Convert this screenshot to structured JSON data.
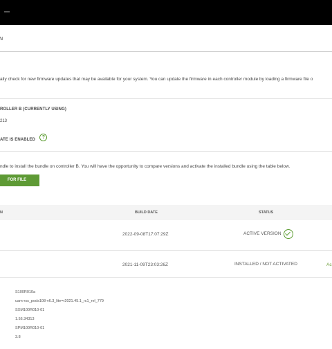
{
  "header": {
    "title": "N"
  },
  "intro": "ally check for new firmware updates that may be available for your system. You can update the firmware in each controller module by loading a firmware file o",
  "controller": {
    "heading": "ROLLER B (CURRENTLY USING)",
    "version": "213",
    "auto_update_label": "ATE IS ENABLED",
    "help_icon": "?"
  },
  "upload": {
    "instructions": "ndle to install the bundle on controller B. You will have the opportunity to compare versions and activate the installed bundle using the table below.",
    "button_label": "FOR FILE"
  },
  "table": {
    "headers": {
      "name": "N",
      "build_date": "BUILD DATE",
      "status": "STATUS"
    },
    "rows": [
      {
        "build_date": "2022-09-08T17:07:29Z",
        "status": "ACTIVE VERSION",
        "action": ""
      },
      {
        "build_date": "2021-11-09T23:03:26Z",
        "status": "INSTALLED / NOT ACTIVATED",
        "action": "Ac"
      }
    ],
    "details": [
      "S100R010a",
      "uam-rss_pods108-v6.3_lite=r2021.45.1_rc1_rel_779",
      "SXM100R010-01",
      "1.56.34313",
      "SPM100R010-01",
      "3.8"
    ]
  },
  "colors": {
    "accent": "#5e9a35",
    "topbar": "#000000"
  }
}
